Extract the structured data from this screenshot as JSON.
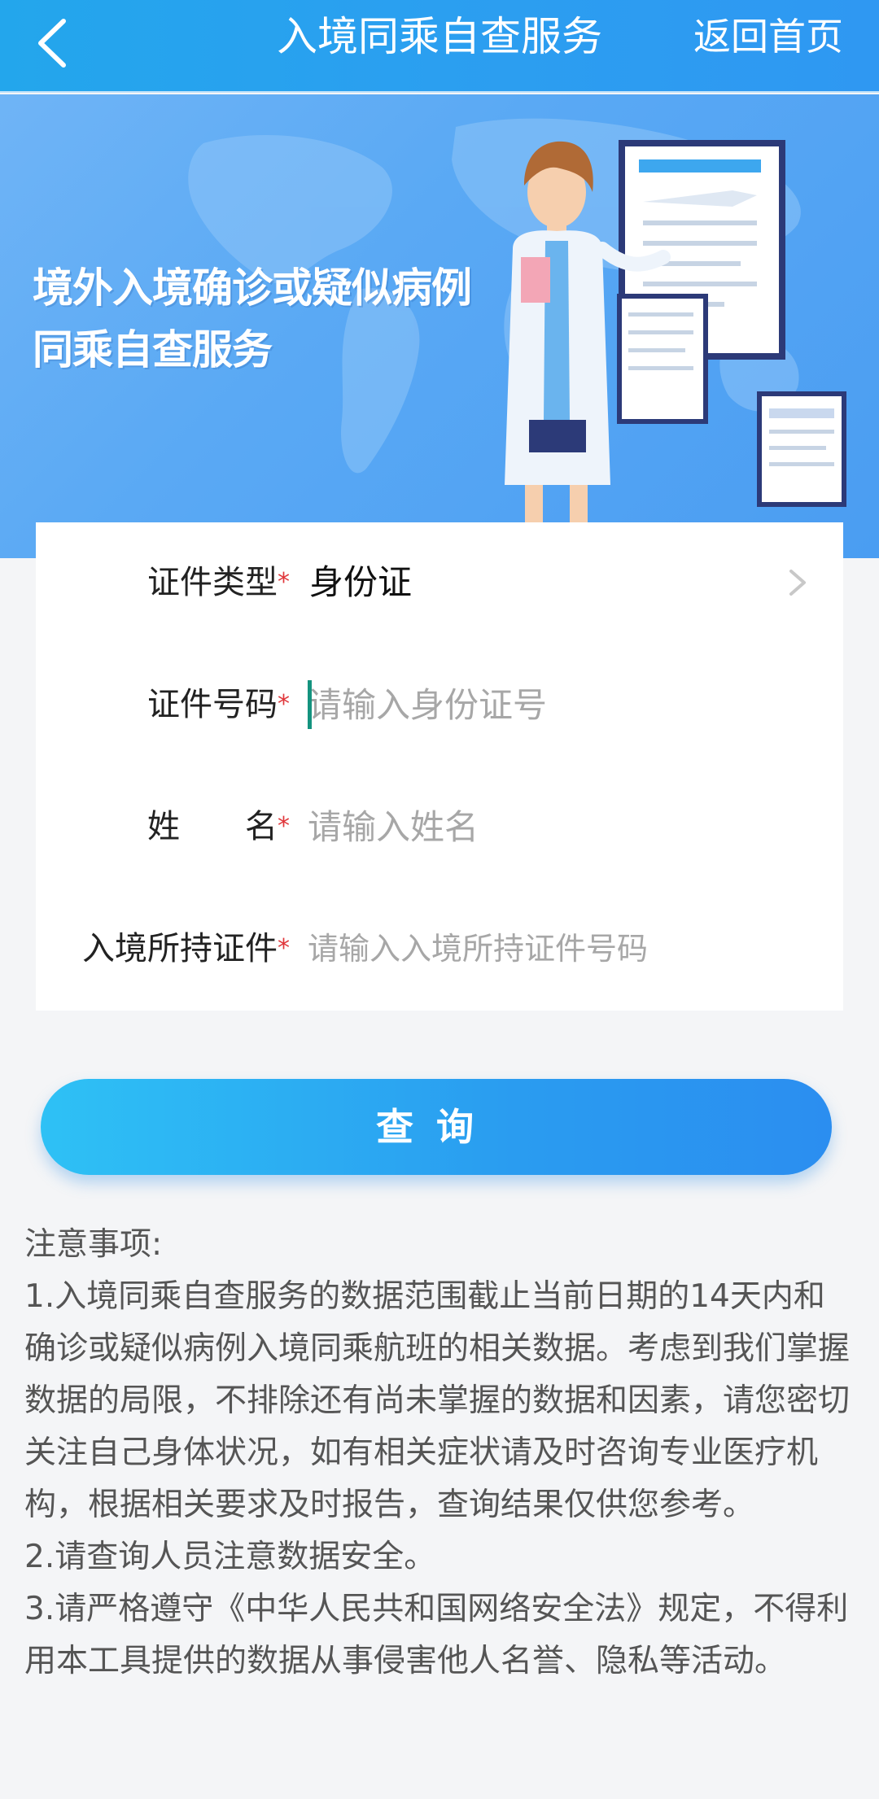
{
  "header": {
    "title": "入境同乘自查服务",
    "home_label": "返回首页"
  },
  "banner": {
    "line1": "境外入境确诊或疑似病例",
    "line2": "同乘自查服务"
  },
  "form": {
    "id_type": {
      "label": "证件类型",
      "value": "身份证"
    },
    "id_number": {
      "label": "证件号码",
      "placeholder": "请输入身份证号"
    },
    "name": {
      "label": "姓　　名",
      "placeholder": "请输入姓名"
    },
    "entry_doc": {
      "label": "入境所持证件",
      "placeholder": "请输入入境所持证件号码"
    },
    "required_mark": "*"
  },
  "query_button": "查询",
  "notes": {
    "title": "注意事项:",
    "items": [
      "1.入境同乘自查服务的数据范围截止当前日期的14天内和确诊或疑似病例入境同乘航班的相关数据。考虑到我们掌握数据的局限，不排除还有尚未掌握的数据和因素，请您密切关注自己身体状况，如有相关症状请及时咨询专业医疗机构，根据相关要求及时报告，查询结果仅供您参考。",
      "2.请查询人员注意数据安全。",
      "3.请严格遵守《中华人民共和国网络安全法》规定，不得利用本工具提供的数据从事侵害他人名誉、隐私等活动。"
    ]
  },
  "colors": {
    "header_bg": "#2ba3ee",
    "button": "#2aa4f0",
    "required": "#e0363a",
    "caret": "#14937f"
  }
}
